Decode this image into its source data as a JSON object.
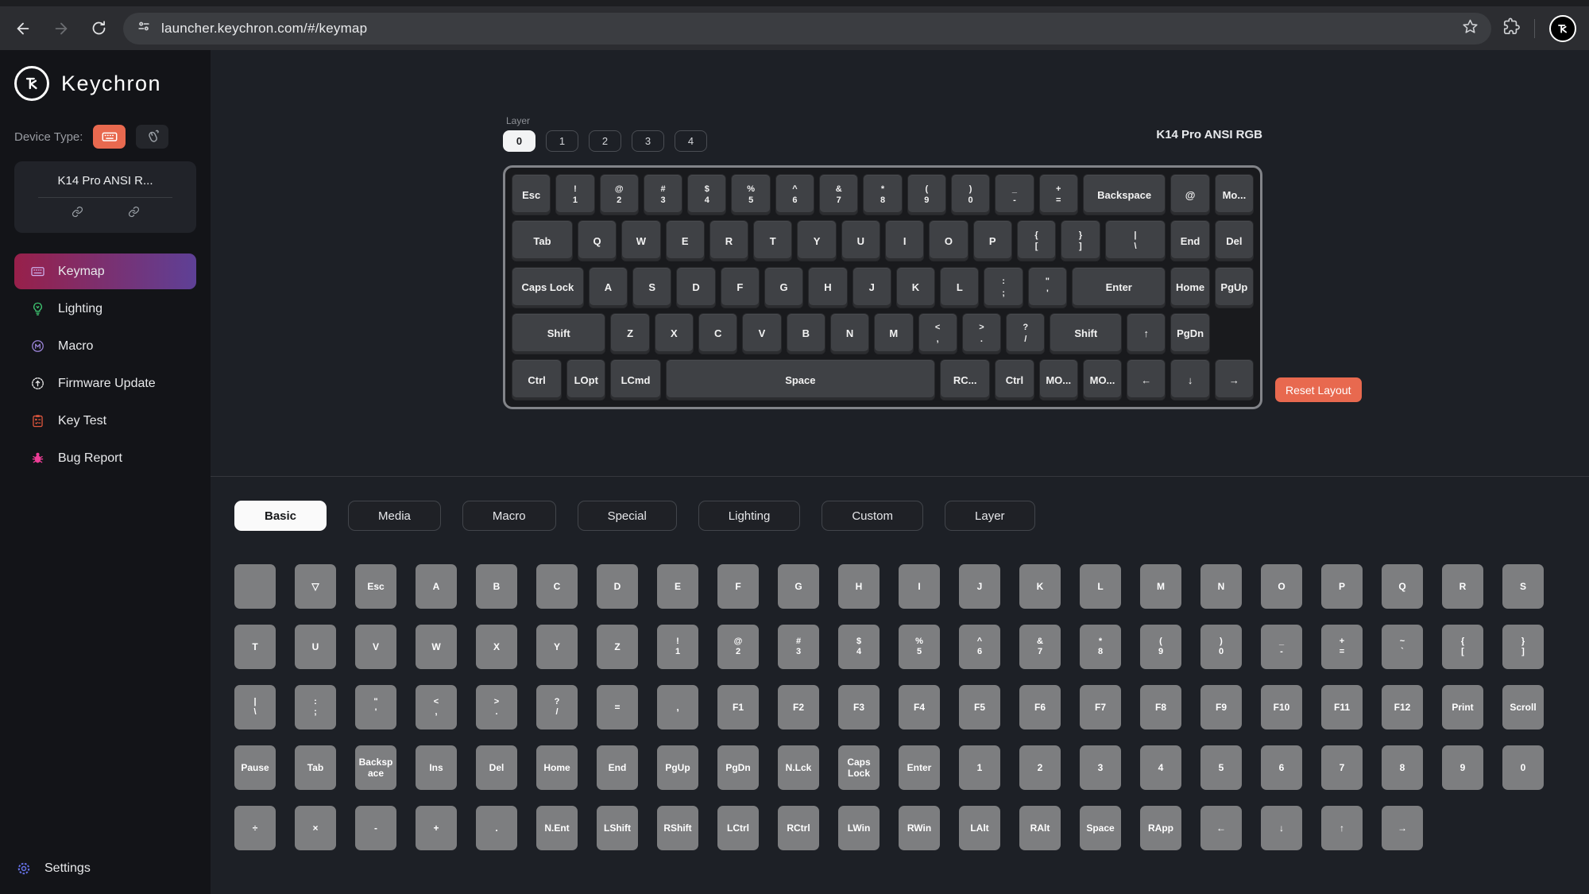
{
  "browser": {
    "url": "launcher.keychron.com/#/keymap"
  },
  "colors": {
    "accent_orange": "#E8694F",
    "menu_active_gradient_from": "#98204A",
    "menu_active_gradient_to": "#5E4096",
    "keyboard_key": "#3F4145",
    "picker_key": "#7D7E80",
    "lighting_icon_green": "#3EC470",
    "macro_icon_purple": "#9B84D8",
    "keytest_icon_red": "#E2573D",
    "bug_icon_pink": "#ED3D96",
    "settings_icon_blue": "#6672E8"
  },
  "sidebar": {
    "brand": "Keychron",
    "device_type_label": "Device Type:",
    "device_name": "K14 Pro ANSI R...",
    "menu": [
      {
        "label": "Keymap",
        "icon": "keymap-icon",
        "active": true
      },
      {
        "label": "Lighting",
        "icon": "lighting-icon",
        "active": false
      },
      {
        "label": "Macro",
        "icon": "macro-icon",
        "active": false
      },
      {
        "label": "Firmware Update",
        "icon": "firmware-icon",
        "active": false
      },
      {
        "label": "Key Test",
        "icon": "keytest-icon",
        "active": false
      },
      {
        "label": "Bug Report",
        "icon": "bug-icon",
        "active": false
      }
    ],
    "settings_label": "Settings"
  },
  "keymap": {
    "layer_label": "Layer",
    "layers": [
      "0",
      "1",
      "2",
      "3",
      "4"
    ],
    "active_layer": "0",
    "title": "K14 Pro ANSI RGB",
    "reset_button": "Reset Layout",
    "rows": [
      [
        {
          "l": "Esc"
        },
        {
          "t": "!",
          "b": "1"
        },
        {
          "t": "@",
          "b": "2"
        },
        {
          "t": "#",
          "b": "3"
        },
        {
          "t": "$",
          "b": "4"
        },
        {
          "t": "%",
          "b": "5"
        },
        {
          "t": "^",
          "b": "6"
        },
        {
          "t": "&",
          "b": "7"
        },
        {
          "t": "*",
          "b": "8"
        },
        {
          "t": "(",
          "b": "9"
        },
        {
          "t": ")",
          "b": "0"
        },
        {
          "t": "_",
          "b": "-"
        },
        {
          "t": "+",
          "b": "="
        },
        {
          "l": "Backspace",
          "w": 2
        },
        {
          "l": "@"
        },
        {
          "l": "Mo..."
        }
      ],
      [
        {
          "l": "Tab",
          "w": 1.5
        },
        {
          "l": "Q"
        },
        {
          "l": "W"
        },
        {
          "l": "E"
        },
        {
          "l": "R"
        },
        {
          "l": "T"
        },
        {
          "l": "Y"
        },
        {
          "l": "U"
        },
        {
          "l": "I"
        },
        {
          "l": "O"
        },
        {
          "l": "P"
        },
        {
          "t": "{",
          "b": "["
        },
        {
          "t": "}",
          "b": "]"
        },
        {
          "t": "|",
          "b": "\\",
          "w": 1.5
        },
        {
          "l": "End"
        },
        {
          "l": "Del"
        }
      ],
      [
        {
          "l": "Caps Lock",
          "w": 1.75
        },
        {
          "l": "A"
        },
        {
          "l": "S"
        },
        {
          "l": "D"
        },
        {
          "l": "F"
        },
        {
          "l": "G"
        },
        {
          "l": "H"
        },
        {
          "l": "J"
        },
        {
          "l": "K"
        },
        {
          "l": "L"
        },
        {
          "t": ":",
          "b": ";"
        },
        {
          "t": "\"",
          "b": "'"
        },
        {
          "l": "Enter",
          "w": 2.25
        },
        {
          "l": "Home"
        },
        {
          "l": "PgUp"
        }
      ],
      [
        {
          "l": "Shift",
          "w": 2.25
        },
        {
          "l": "Z"
        },
        {
          "l": "X"
        },
        {
          "l": "C"
        },
        {
          "l": "V"
        },
        {
          "l": "B"
        },
        {
          "l": "N"
        },
        {
          "l": "M"
        },
        {
          "t": "<",
          "b": ","
        },
        {
          "t": ">",
          "b": "."
        },
        {
          "t": "?",
          "b": "/"
        },
        {
          "l": "Shift",
          "w": 1.75
        },
        {
          "l": "↑"
        },
        {
          "l": "PgDn"
        }
      ],
      [
        {
          "l": "Ctrl",
          "w": 1.25
        },
        {
          "l": "LOpt"
        },
        {
          "l": "LCmd",
          "w": 1.25
        },
        {
          "l": "Space",
          "w": 6.25
        },
        {
          "l": "RC...",
          "w": 1.25
        },
        {
          "l": "Ctrl"
        },
        {
          "l": "MO..."
        },
        {
          "l": "MO..."
        },
        {
          "l": "←"
        },
        {
          "l": "↓"
        },
        {
          "l": "→"
        }
      ]
    ]
  },
  "picker": {
    "tabs": [
      "Basic",
      "Media",
      "Macro",
      "Special",
      "Lighting",
      "Custom",
      "Layer"
    ],
    "active_tab": "Basic",
    "rows": [
      [
        {
          "l": ""
        },
        {
          "l": "▽"
        },
        {
          "l": "Esc"
        },
        {
          "l": "A"
        },
        {
          "l": "B"
        },
        {
          "l": "C"
        },
        {
          "l": "D"
        },
        {
          "l": "E"
        },
        {
          "l": "F"
        },
        {
          "l": "G"
        },
        {
          "l": "H"
        },
        {
          "l": "I"
        },
        {
          "l": "J"
        },
        {
          "l": "K"
        },
        {
          "l": "L"
        },
        {
          "l": "M"
        },
        {
          "l": "N"
        },
        {
          "l": "O"
        },
        {
          "l": "P"
        },
        {
          "l": "Q"
        },
        {
          "l": "R"
        },
        {
          "l": "S"
        }
      ],
      [
        {
          "l": "T"
        },
        {
          "l": "U"
        },
        {
          "l": "V"
        },
        {
          "l": "W"
        },
        {
          "l": "X"
        },
        {
          "l": "Y"
        },
        {
          "l": "Z"
        },
        {
          "t": "!",
          "b": "1"
        },
        {
          "t": "@",
          "b": "2"
        },
        {
          "t": "#",
          "b": "3"
        },
        {
          "t": "$",
          "b": "4"
        },
        {
          "t": "%",
          "b": "5"
        },
        {
          "t": "^",
          "b": "6"
        },
        {
          "t": "&",
          "b": "7"
        },
        {
          "t": "*",
          "b": "8"
        },
        {
          "t": "(",
          "b": "9"
        },
        {
          "t": ")",
          "b": "0"
        },
        {
          "t": "_",
          "b": "-"
        },
        {
          "t": "+",
          "b": "="
        },
        {
          "t": "~",
          "b": "`"
        },
        {
          "t": "{",
          "b": "["
        },
        {
          "t": "}",
          "b": "]"
        }
      ],
      [
        {
          "t": "|",
          "b": "\\"
        },
        {
          "t": ":",
          "b": ";"
        },
        {
          "t": "\"",
          "b": "'"
        },
        {
          "t": "<",
          "b": ","
        },
        {
          "t": ">",
          "b": "."
        },
        {
          "t": "?",
          "b": "/"
        },
        {
          "l": "="
        },
        {
          "l": ","
        },
        {
          "l": "F1"
        },
        {
          "l": "F2"
        },
        {
          "l": "F3"
        },
        {
          "l": "F4"
        },
        {
          "l": "F5"
        },
        {
          "l": "F6"
        },
        {
          "l": "F7"
        },
        {
          "l": "F8"
        },
        {
          "l": "F9"
        },
        {
          "l": "F10"
        },
        {
          "l": "F11"
        },
        {
          "l": "F12"
        },
        {
          "l": "Print"
        },
        {
          "l": "Scroll"
        }
      ],
      [
        {
          "l": "Pause"
        },
        {
          "l": "Tab"
        },
        {
          "l": "Backspace"
        },
        {
          "l": "Ins"
        },
        {
          "l": "Del"
        },
        {
          "l": "Home"
        },
        {
          "l": "End"
        },
        {
          "l": "PgUp"
        },
        {
          "l": "PgDn"
        },
        {
          "l": "N.Lck"
        },
        {
          "l": "Caps Lock"
        },
        {
          "l": "Enter"
        },
        {
          "l": "1"
        },
        {
          "l": "2"
        },
        {
          "l": "3"
        },
        {
          "l": "4"
        },
        {
          "l": "5"
        },
        {
          "l": "6"
        },
        {
          "l": "7"
        },
        {
          "l": "8"
        },
        {
          "l": "9"
        },
        {
          "l": "0"
        }
      ],
      [
        {
          "l": "÷"
        },
        {
          "l": "×"
        },
        {
          "l": "-"
        },
        {
          "l": "+"
        },
        {
          "l": "."
        },
        {
          "l": "N.Ent"
        },
        {
          "l": "LShift"
        },
        {
          "l": "RShift"
        },
        {
          "l": "LCtrl"
        },
        {
          "l": "RCtrl"
        },
        {
          "l": "LWin"
        },
        {
          "l": "RWin"
        },
        {
          "l": "LAlt"
        },
        {
          "l": "RAlt"
        },
        {
          "l": "Space"
        },
        {
          "l": "RApp"
        },
        {
          "l": "←"
        },
        {
          "l": "↓"
        },
        {
          "l": "↑"
        },
        {
          "l": "→"
        }
      ]
    ]
  }
}
